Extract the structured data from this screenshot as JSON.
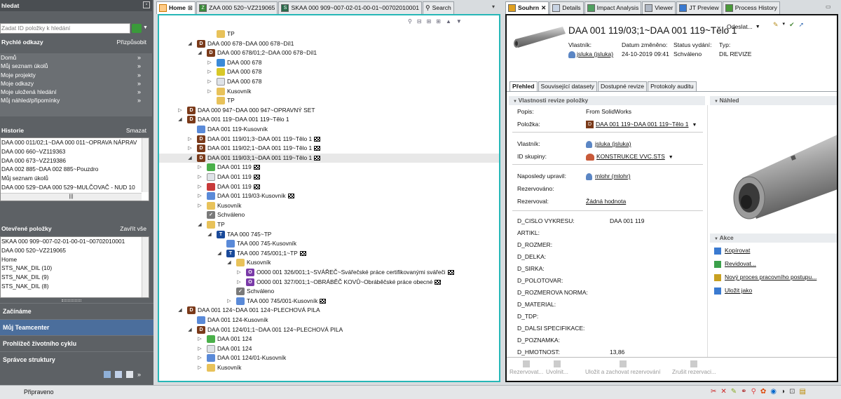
{
  "left": {
    "search_title": "hledat",
    "search_placeholder": "Zadat ID položky k hledání",
    "quick_links_title": "Rychlé odkazy",
    "quick_links_action": "Přizpůsobit",
    "quick_links": [
      "Domů",
      "Můj seznam úkolů",
      "Moje projekty",
      "Moje odkazy",
      "Moje uložená hledání",
      "Můj náhled/připomínky"
    ],
    "history_title": "Historie",
    "history_action": "Smazat",
    "history": [
      "DAA 000 011/02;1~DAA 000 011~OPRAVA NÁPRAV",
      "DAA 000 660~VZ119363",
      "DAA 000 673~VZ219386",
      "DAA 002 885~DAA 002 885~Pouzdro",
      "Můj seznam úkolů",
      "DAA 000 529~DAA 000 529~MULČOVAČ - NUD 10"
    ],
    "open_title": "Otevřené položky",
    "open_action": "Zavřít vše",
    "open_items": [
      "SKAA 000 909~007-02-01-00-01~00702010001",
      "DAA 000 520~VZ219065",
      "Home",
      "STS_NAK_DIL (10)",
      "STS_NAK_DIL (9)",
      "STS_NAK_DIL (8)"
    ],
    "nav": [
      "Začínáme",
      "Můj Teamcenter",
      "Prohlížeč životního cyklu",
      "Správce struktury"
    ]
  },
  "mid": {
    "tabs": [
      "Home",
      "ZAA 000 520~VZ219065",
      "SKAA 000 909~007-02-01-00-01~00702010001",
      "Search"
    ],
    "tree": [
      {
        "d": 3,
        "t": "",
        "icon": "folder",
        "label": "TP",
        "flag": false
      },
      {
        "d": 1,
        "t": "down",
        "icon": "D",
        "label": "DAA 000 678~DAA 000 678~Díl1",
        "flag": false
      },
      {
        "d": 2,
        "t": "down",
        "icon": "D",
        "label": "DAA 000 678/01;2~DAA 000 678~Díl1",
        "flag": false
      },
      {
        "d": 3,
        "t": "right",
        "icon": "globe",
        "label": "DAA 000 678",
        "flag": false
      },
      {
        "d": 3,
        "t": "right",
        "icon": "yellow",
        "label": "DAA 000 678",
        "flag": false
      },
      {
        "d": 3,
        "t": "right",
        "icon": "doc",
        "label": "DAA 000 678",
        "flag": false
      },
      {
        "d": 3,
        "t": "right",
        "icon": "folder",
        "label": "Kusovník",
        "flag": false
      },
      {
        "d": 3,
        "t": "",
        "icon": "folder",
        "label": "TP",
        "flag": false
      },
      {
        "d": 0,
        "t": "right",
        "icon": "D",
        "label": "DAA 000 947~DAA 000 947~OPRAVNÝ SET",
        "flag": false
      },
      {
        "d": 0,
        "t": "down",
        "icon": "D",
        "label": "DAA 001 119~DAA 001 119~Tělo 1",
        "flag": false
      },
      {
        "d": 1,
        "t": "",
        "icon": "bom",
        "label": "DAA 001 119-Kusovník",
        "flag": false
      },
      {
        "d": 1,
        "t": "right",
        "icon": "D",
        "label": "DAA 001 119/01;3~DAA 001 119~Tělo 1",
        "flag": true
      },
      {
        "d": 1,
        "t": "right",
        "icon": "D",
        "label": "DAA 001 119/02;1~DAA 001 119~Tělo 1",
        "flag": true
      },
      {
        "d": 1,
        "t": "down",
        "icon": "D",
        "label": "DAA 001 119/03;1~DAA 001 119~Tělo 1",
        "flag": true
      },
      {
        "d": 2,
        "t": "right",
        "icon": "green",
        "label": "DAA 001 119",
        "flag": true
      },
      {
        "d": 2,
        "t": "right",
        "icon": "doc",
        "label": "DAA 001 119",
        "flag": true
      },
      {
        "d": 2,
        "t": "right",
        "icon": "pdf",
        "label": "DAA 001 119",
        "flag": true
      },
      {
        "d": 2,
        "t": "right",
        "icon": "bom",
        "label": "DAA 001 119/03-Kusovník",
        "flag": true
      },
      {
        "d": 2,
        "t": "right",
        "icon": "folder",
        "label": "Kusovník",
        "flag": false
      },
      {
        "d": 2,
        "t": "",
        "icon": "check",
        "label": "Schváleno",
        "flag": false
      },
      {
        "d": 2,
        "t": "down",
        "icon": "folder",
        "label": "TP",
        "flag": false
      },
      {
        "d": 3,
        "t": "down",
        "icon": "T",
        "label": "TAA 000 745~TP",
        "flag": false
      },
      {
        "d": 4,
        "t": "",
        "icon": "bom",
        "label": "TAA 000 745-Kusovník",
        "flag": false
      },
      {
        "d": 4,
        "t": "down",
        "icon": "T",
        "label": "TAA 000 745/001;1~TP",
        "flag": true
      },
      {
        "d": 5,
        "t": "down",
        "icon": "folder",
        "label": "Kusovník",
        "flag": false
      },
      {
        "d": 6,
        "t": "right",
        "icon": "O",
        "label": "O000 001 326/001;1~SVÁŘEČ~Svářečské práce certifikovanými svářeči",
        "flag": true
      },
      {
        "d": 6,
        "t": "right",
        "icon": "O",
        "label": "O000 001 327/001;1~OBRÁBĚČ KOVŮ~Obráběčské práce obecné",
        "flag": true
      },
      {
        "d": 5,
        "t": "",
        "icon": "check",
        "label": "Schváleno",
        "flag": false
      },
      {
        "d": 5,
        "t": "right",
        "icon": "bom",
        "label": "TAA 000 745/001-Kusovník",
        "flag": true
      },
      {
        "d": 0,
        "t": "down",
        "icon": "D",
        "label": "DAA 001 124~DAA 001 124~PLECHOVÁ PILA",
        "flag": false
      },
      {
        "d": 1,
        "t": "",
        "icon": "bom",
        "label": "DAA 001 124-Kusovník",
        "flag": false
      },
      {
        "d": 1,
        "t": "down",
        "icon": "D",
        "label": "DAA 001 124/01;1~DAA 001 124~PLECHOVÁ PILA",
        "flag": false
      },
      {
        "d": 2,
        "t": "right",
        "icon": "green",
        "label": "DAA 001 124",
        "flag": false
      },
      {
        "d": 2,
        "t": "right",
        "icon": "doc",
        "label": "DAA 001 124",
        "flag": false
      },
      {
        "d": 2,
        "t": "right",
        "icon": "bom",
        "label": "DAA 001 124/01-Kusovník",
        "flag": false
      },
      {
        "d": 2,
        "t": "right",
        "icon": "folder",
        "label": "Kusovník",
        "flag": false
      }
    ]
  },
  "right": {
    "tabs": [
      "Souhrn",
      "Details",
      "Impact Analysis",
      "Viewer",
      "JT Preview",
      "Process History"
    ],
    "title": "DAA 001 119/03;1~DAA 001 119~Tělo 1",
    "send_label": "Odeslat...",
    "meta_headers": [
      "Vlastník:",
      "Datum změněno:",
      "Status vydání:",
      "Typ:"
    ],
    "meta_values": [
      "jsluka (jsluka)",
      "24-10-2019 09:41",
      "Schváleno",
      "DIL REVIZE"
    ],
    "subtabs": [
      "Přehled",
      "Související datasety",
      "Dostupné revize",
      "Protokoly auditu"
    ],
    "props_header": "Vlastnosti revize položky",
    "preview_header": "Náhled",
    "actions_header": "Akce",
    "props": [
      {
        "k": "Popis:",
        "v": "From SolidWorks"
      },
      {
        "k": "Položka:",
        "v": "DAA 001 119~DAA 001 119~Tělo 1"
      },
      {
        "k": "Vlastník:",
        "v": "jsluka (jsluka)"
      },
      {
        "k": "ID skupiny:",
        "v": "KONSTRUKCE VVC.STS"
      },
      {
        "k": "Naposledy upravil:",
        "v": "mlohr (mlohr)"
      },
      {
        "k": "Rezervováno:",
        "v": ""
      },
      {
        "k": "Rezervoval:",
        "v": "Žádná hodnota"
      }
    ],
    "dprops": [
      {
        "k": "D_CISLO VYKRESU:",
        "v": "DAA 001 119"
      },
      {
        "k": "ARTIKL:",
        "v": ""
      },
      {
        "k": "D_ROZMER:",
        "v": ""
      },
      {
        "k": "D_DELKA:",
        "v": ""
      },
      {
        "k": "D_SIRKA:",
        "v": ""
      },
      {
        "k": "D_POLOTOVAR:",
        "v": ""
      },
      {
        "k": "D_ROZMEROVA NORMA:",
        "v": ""
      },
      {
        "k": "D_MATERIAL:",
        "v": ""
      },
      {
        "k": "D_TDP:",
        "v": ""
      },
      {
        "k": "D_DALSI SPECIFIKACE:",
        "v": ""
      },
      {
        "k": "D_POZNAMKA:",
        "v": ""
      },
      {
        "k": "D_HMOTNOST:",
        "v": "13,86"
      }
    ],
    "actions": [
      "Kopírovat",
      "Revidovat...",
      "Nový proces pracovního postupu...",
      "Uložit jako"
    ],
    "bottom_buttons": [
      "Rezervovat...",
      "Uvolnit...",
      "Uložit a zachovat rezervování",
      "Zrušit rezervaci..."
    ]
  },
  "status": {
    "text": "Připraveno"
  }
}
